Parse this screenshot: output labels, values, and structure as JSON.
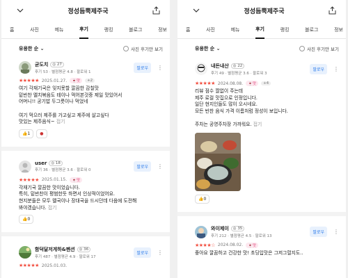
{
  "left": {
    "title": "정성듬뿍제주국",
    "tabs": [
      "홈",
      "사진",
      "메뉴",
      "후기",
      "랭킹",
      "블로그",
      "정보"
    ],
    "sort_label": "유용한 순 ⌄",
    "photo_filter": "사진 후기만 보기",
    "reviews": [
      {
        "name": "굳도치",
        "level": "◎ 27",
        "stats": "후기 53 · 별점평균 4.8 · 팔로워 1",
        "follow": "팔로우",
        "stars": "★★★★★",
        "date": "2025.01.27.",
        "tag": "🍷맛",
        "plus": "+2",
        "text": "여기 각재기국은 잊지못할 깔끔한 감칠맛\n밑반찬 멜치볶음도 테이나 먹어본것중 제일 맛있어서\n어머니!! 공기밥 두그릇이나 먹었네\n\n여기 먹으러 제주를 가고싶고 제주에 살고싶다\n맛있는 제주음식~",
        "fold": "접기",
        "like": "👍1"
      },
      {
        "name": "user",
        "level": "◎ 18",
        "stats": "후기 36 · 별점평균 3.6 · 팔로워 0",
        "follow": "팔로우",
        "stars": "★★★★★",
        "date": "2025.01.15.",
        "tag": "🍷맛",
        "text": "각재기국 깔끔한 맛이었습니다.\n특히, 밑반찬이 평범한듯 하면서 인상적이었어요.\n현지분들은 모두 멜국이나 장대국을 드시던데 다음에 도전해\n봐야겠습니다.",
        "fold": "접기",
        "like": "👍0"
      },
      {
        "name": "함덕달저게하&펜션",
        "level": "◎ 36",
        "stats": "후기 487 · 별점평균 4.9 · 팔로워 17",
        "follow": "팔로우",
        "stars": "★★★★★",
        "date": "2025.01.03."
      }
    ]
  },
  "right": {
    "title": "정성듬뿍제주국",
    "tabs": [
      "홈",
      "사진",
      "메뉴",
      "후기",
      "랭킹",
      "블로그",
      "정보"
    ],
    "sort_label": "유용한 순 ⌄",
    "photo_filter": "사진 후기만 보기",
    "reviews": [
      {
        "name": "내돈내산",
        "level": "◎ 22",
        "stats": "후기 49 · 별점평균 3.6 · 팔로워 3",
        "follow": "팔로우",
        "stars": "★★★★★",
        "date": "2024.08.08.",
        "tag": "🍷맛",
        "plus": "+4",
        "text": "리뷰 점수 짤없이 주는데\n제주 로컬 맛집으로 인정입니다.\n일단 현지인들도 많이 오시네요.\n모든 반찬 음식 가격 이름처럼 정성이 보입니다.\n\n주차는 공영주차장 가까워요.",
        "fold": "접기",
        "like": "👍0"
      },
      {
        "name": "와이제이",
        "level": "◎ 35",
        "stats": "후기 212 · 별점평균 4.5 · 팔로워 13",
        "follow": "팔로우",
        "stars": "★★★★☆",
        "date": "2024.08.02.",
        "tag": "🍷맛",
        "text": "좋아요 깔끔하고 건강한 맛! 초딩입맛은 그저그럴지도.."
      }
    ]
  },
  "colors": {
    "accent": "#2b7bea",
    "star": "#f24c3d",
    "tag": "#e0457a"
  }
}
